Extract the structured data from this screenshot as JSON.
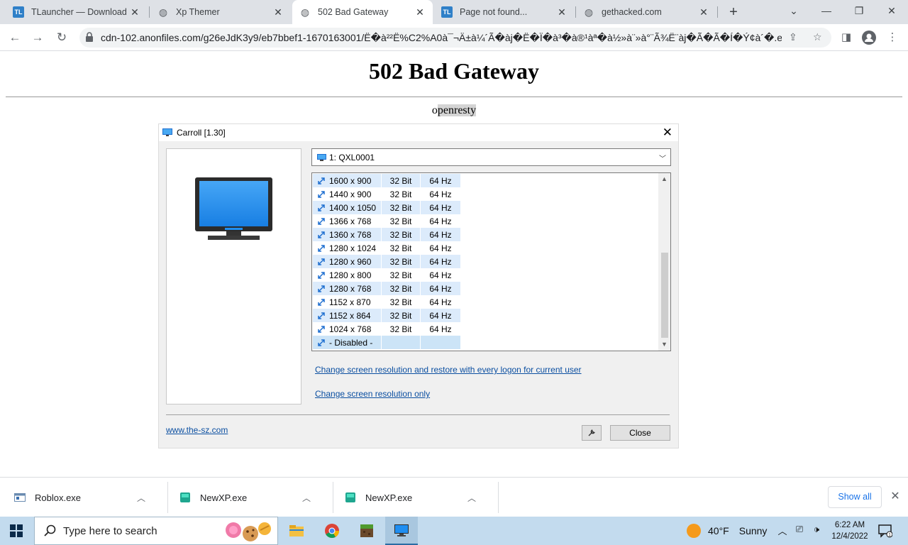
{
  "browser": {
    "tabs": [
      {
        "title": "TLauncher — Download I",
        "favicon": "tlauncher-icon",
        "active": false
      },
      {
        "title": "Xp Themer",
        "favicon": "globe-icon",
        "active": false
      },
      {
        "title": "502 Bad Gateway",
        "favicon": "globe-icon",
        "active": true
      },
      {
        "title": "Page not found...",
        "favicon": "tlauncher-icon",
        "active": false
      },
      {
        "title": "gethacked.com",
        "favicon": "globe-icon",
        "active": false
      }
    ],
    "new_tab_label": "+",
    "url": "cdn-102.anonfiles.com/g26eJdK3y9/eb7bbef1-1670163001/Ë�à²²Ë%C2%A0à¯¬Ä±à¼´Ã�àj�Ë�Ï�à³�à®¹àª�à½»à¨»à°¨Ã¾Ë¨àj�Ã�Ã�Í�Ý¢à´�.exe"
  },
  "page": {
    "heading": "502 Bad Gateway",
    "server_prefix": "o",
    "server_highlight": "penresty"
  },
  "dialog": {
    "title": "Carroll [1.30]",
    "monitor_select": "1: QXL0001",
    "modes": [
      {
        "res": "1600 x 900",
        "depth": "32 Bit",
        "hz": "64 Hz"
      },
      {
        "res": "1440 x 900",
        "depth": "32 Bit",
        "hz": "64 Hz"
      },
      {
        "res": "1400 x 1050",
        "depth": "32 Bit",
        "hz": "64 Hz"
      },
      {
        "res": "1366 x 768",
        "depth": "32 Bit",
        "hz": "64 Hz"
      },
      {
        "res": "1360 x 768",
        "depth": "32 Bit",
        "hz": "64 Hz"
      },
      {
        "res": "1280 x 1024",
        "depth": "32 Bit",
        "hz": "64 Hz"
      },
      {
        "res": "1280 x 960",
        "depth": "32 Bit",
        "hz": "64 Hz"
      },
      {
        "res": "1280 x 800",
        "depth": "32 Bit",
        "hz": "64 Hz"
      },
      {
        "res": "1280 x 768",
        "depth": "32 Bit",
        "hz": "64 Hz"
      },
      {
        "res": "1152 x 870",
        "depth": "32 Bit",
        "hz": "64 Hz"
      },
      {
        "res": "1152 x 864",
        "depth": "32 Bit",
        "hz": "64 Hz"
      },
      {
        "res": "1024 x 768",
        "depth": "32 Bit",
        "hz": "64 Hz"
      },
      {
        "res": "- Disabled -",
        "depth": "",
        "hz": ""
      }
    ],
    "link_restore": "Change screen resolution and restore with every logon for current user",
    "link_only": "Change screen resolution only",
    "site": "www.the-sz.com",
    "close_label": "Close"
  },
  "downloads": {
    "items": [
      {
        "name": "Roblox.exe",
        "icon": "installer-icon"
      },
      {
        "name": "NewXP.exe",
        "icon": "app-icon"
      },
      {
        "name": "NewXP.exe",
        "icon": "app-icon"
      }
    ],
    "show_all": "Show all"
  },
  "taskbar": {
    "search_placeholder": "Type here to search",
    "apps": [
      "file-explorer-icon",
      "chrome-icon",
      "minecraft-icon",
      "carroll-icon"
    ],
    "weather_temp": "40°F",
    "weather_cond": "Sunny",
    "time": "6:22 AM",
    "date": "12/4/2022"
  }
}
